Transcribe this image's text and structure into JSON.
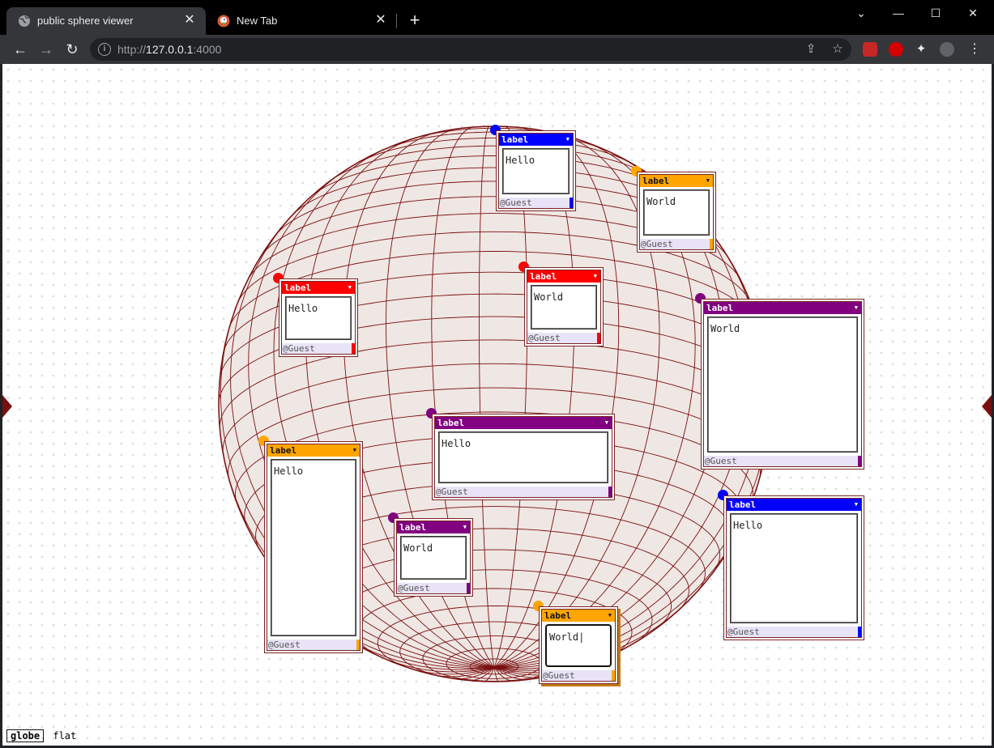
{
  "browser": {
    "tabs": [
      {
        "title": "public sphere viewer",
        "active": true
      },
      {
        "title": "New Tab",
        "active": false
      }
    ],
    "address": {
      "prefix": "http://",
      "host": "127.0.0.1",
      "port": ":4000"
    },
    "new_tab_icon": "+",
    "close_icon": "✕"
  },
  "colors": {
    "globe_fill": "#efe7e4",
    "globe_lines": "#7a0f0f",
    "blue": "#0000ff",
    "orange": "#ffa500",
    "red": "#ff0000",
    "purple": "#800080"
  },
  "cards": [
    {
      "label": "label",
      "text": "Hello",
      "user": "@Guest",
      "color": "blue"
    },
    {
      "label": "label",
      "text": "World",
      "user": "@Guest",
      "color": "orange"
    },
    {
      "label": "label",
      "text": "Hello",
      "user": "@Guest",
      "color": "red"
    },
    {
      "label": "label",
      "text": "World",
      "user": "@Guest",
      "color": "red"
    },
    {
      "label": "label",
      "text": "World",
      "user": "@Guest",
      "color": "purple"
    },
    {
      "label": "label",
      "text": "Hello",
      "user": "@Guest",
      "color": "purple"
    },
    {
      "label": "label",
      "text": "Hello",
      "user": "@Guest",
      "color": "orange"
    },
    {
      "label": "label",
      "text": "World",
      "user": "@Guest",
      "color": "purple"
    },
    {
      "label": "label",
      "text": "Hello",
      "user": "@Guest",
      "color": "blue"
    },
    {
      "label": "label",
      "text": "World",
      "user": "@Guest",
      "color": "orange",
      "focused": true
    }
  ],
  "view_modes": {
    "globe": "globe",
    "flat": "flat",
    "active": "globe"
  }
}
